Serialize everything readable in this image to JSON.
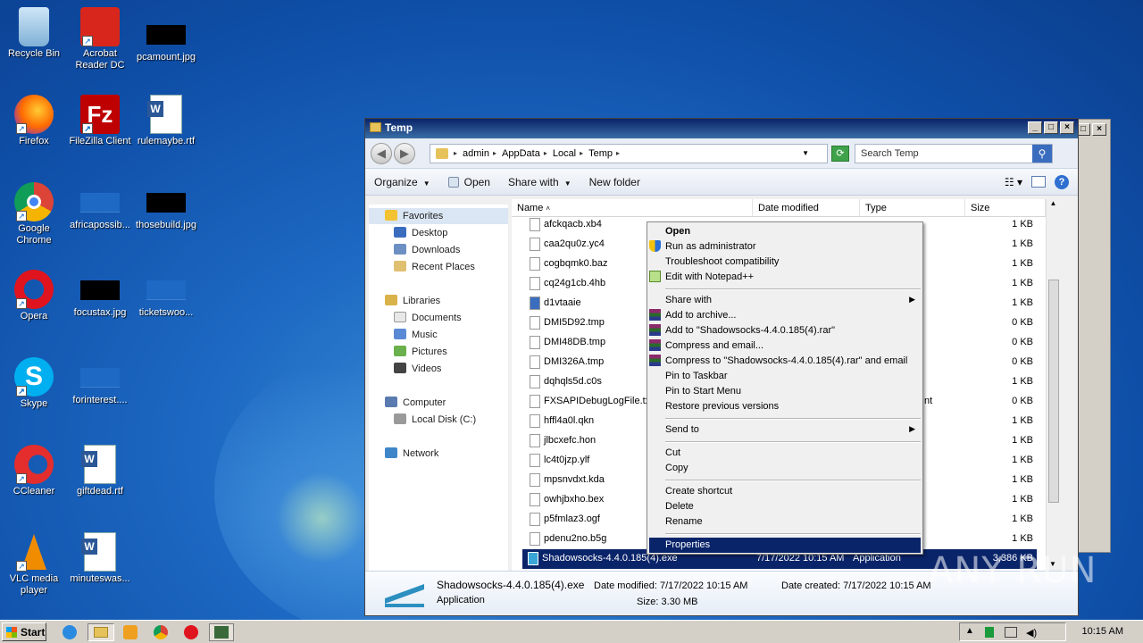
{
  "desktop": {
    "icons": [
      {
        "label": "Recycle Bin"
      },
      {
        "label": "Acrobat Reader DC"
      },
      {
        "label": "pcamount.jpg"
      },
      {
        "label": "Firefox"
      },
      {
        "label": "FileZilla Client"
      },
      {
        "label": "rulemaybe.rtf"
      },
      {
        "label": "Google Chrome"
      },
      {
        "label": "africapossib..."
      },
      {
        "label": "thosebuild.jpg"
      },
      {
        "label": "Opera"
      },
      {
        "label": "focustax.jpg"
      },
      {
        "label": "ticketswoo..."
      },
      {
        "label": "Skype"
      },
      {
        "label": "forinterest...."
      },
      {
        "label": "CCleaner"
      },
      {
        "label": "giftdead.rtf"
      },
      {
        "label": "VLC media player"
      },
      {
        "label": "minuteswas..."
      }
    ]
  },
  "window": {
    "title": "Temp",
    "breadcrumbs": [
      "admin",
      "AppData",
      "Local",
      "Temp"
    ],
    "search_placeholder": "Search Temp",
    "toolbar": {
      "organize": "Organize",
      "open": "Open",
      "share_with": "Share with",
      "new_folder": "New folder"
    },
    "nav": {
      "favorites": "Favorites",
      "desktop": "Desktop",
      "downloads": "Downloads",
      "recent": "Recent Places",
      "libraries": "Libraries",
      "documents": "Documents",
      "music": "Music",
      "pictures": "Pictures",
      "videos": "Videos",
      "computer": "Computer",
      "local_disk": "Local Disk (C:)",
      "network": "Network"
    },
    "columns": {
      "name": "Name",
      "date": "Date modified",
      "type": "Type",
      "size": "Size"
    },
    "files": [
      {
        "name": "afckqacb.xb4",
        "size": "1 KB"
      },
      {
        "name": "caa2qu0z.yc4",
        "size": "1 KB"
      },
      {
        "name": "cogbqmk0.baz",
        "size": "1 KB"
      },
      {
        "name": "cq24g1cb.4hb",
        "size": "1 KB"
      },
      {
        "name": "d1vtaaie",
        "size": "1 KB"
      },
      {
        "name": "DMI5D92.tmp",
        "size": "0 KB"
      },
      {
        "name": "DMI48DB.tmp",
        "size": "0 KB"
      },
      {
        "name": "DMI326A.tmp",
        "size": "0 KB"
      },
      {
        "name": "dqhqls5d.c0s",
        "size": "1 KB"
      },
      {
        "name": "FXSAPIDebugLogFile.txt",
        "size": "0 KB"
      },
      {
        "name": "hffl4a0l.qkn",
        "size": "1 KB"
      },
      {
        "name": "jlbcxefc.hon",
        "size": "1 KB"
      },
      {
        "name": "lc4t0jzp.ylf",
        "size": "1 KB"
      },
      {
        "name": "mpsnvdxt.kda",
        "size": "1 KB"
      },
      {
        "name": "owhjbxho.bex",
        "size": "1 KB"
      },
      {
        "name": "p5fmlaz3.ogf",
        "size": "1 KB"
      },
      {
        "name": "pdenu2no.b5g",
        "size": "1 KB"
      }
    ],
    "selected_file": {
      "name": "Shadowsocks-4.4.0.185(4).exe",
      "date": "7/17/2022 10:15 AM",
      "type": "Application",
      "size": "3,386 KB"
    },
    "details": {
      "name": "Shadowsocks-4.4.0.185(4).exe",
      "type": "Application",
      "date_modified_label": "Date modified:",
      "date_modified": "7/17/2022 10:15 AM",
      "size_label": "Size:",
      "size": "3.30 MB",
      "date_created_label": "Date created:",
      "date_created": "7/17/2022 10:15 AM"
    }
  },
  "context_menu": {
    "open": "Open",
    "run_admin": "Run as administrator",
    "troubleshoot": "Troubleshoot compatibility",
    "notepad": "Edit with Notepad++",
    "share_with": "Share with",
    "add_archive": "Add to archive...",
    "add_rar": "Add to \"Shadowsocks-4.4.0.185(4).rar\"",
    "compress_email": "Compress and email...",
    "compress_rar_email": "Compress to \"Shadowsocks-4.4.0.185(4).rar\" and email",
    "pin_taskbar": "Pin to Taskbar",
    "pin_start": "Pin to Start Menu",
    "restore": "Restore previous versions",
    "send_to": "Send to",
    "cut": "Cut",
    "copy": "Copy",
    "create_shortcut": "Create shortcut",
    "delete": "Delete",
    "rename": "Rename",
    "properties": "Properties"
  },
  "taskbar": {
    "start": "Start",
    "clock": "10:15 AM"
  },
  "watermark": "ANY RUN"
}
